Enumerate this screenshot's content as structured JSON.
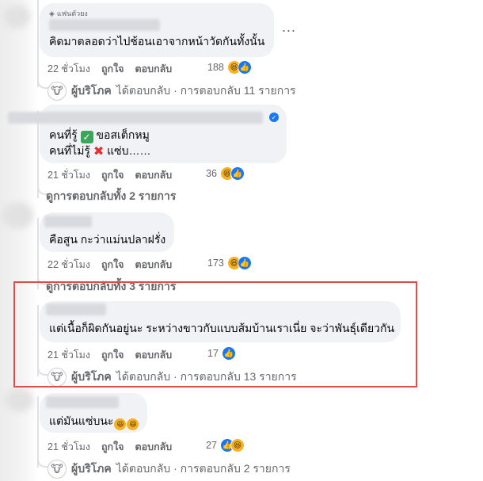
{
  "comments": [
    {
      "badge": "แฟนตัวยง",
      "lines": [
        "คิดมาตลอดว่าไปช้อนเอาจากหน้าวัดกันทั้งนั้น"
      ],
      "time": "22 ชั่วโมง",
      "like": "ถูกใจ",
      "reply": "ตอบกลับ",
      "reaction_count": "188",
      "reactions": [
        "haha-icon",
        "like-icon"
      ],
      "more": "...",
      "reply_summary": {
        "author": "ผู้บริโภค",
        "text": "ได้ตอบกลับ · การตอบกลับ 11 รายการ"
      }
    },
    {
      "lines": [
        "คนที่รู้ ✅ ขอสเต็กหมู",
        "คนที่ไม่รู้ ❌ แซ่บ……"
      ],
      "line1_a": "คนที่รู้",
      "line1_b": "ขอสเต็กหมู",
      "line2_a": "คนที่ไม่รู้",
      "line2_b": "แซ่บ……",
      "time": "21 ชั่วโมง",
      "like": "ถูกใจ",
      "reply": "ตอบกลับ",
      "reaction_count": "36",
      "reactions": [
        "haha-icon",
        "like-icon"
      ],
      "view_replies": "ดูการตอบกลับทั้ง 2 รายการ"
    },
    {
      "lines": [
        "คือสูน กะว่าแม่นปลาฝรั่ง"
      ],
      "time": "22 ชั่วโมง",
      "like": "ถูกใจ",
      "reply": "ตอบกลับ",
      "reaction_count": "173",
      "reactions": [
        "haha-icon",
        "like-icon"
      ],
      "view_replies": "ดูการตอบกลับทั้ง 3 รายการ"
    },
    {
      "lines": [
        "แต่เนื้อก็ผิดกันอยู่นะ ระหว่างขาวกับแบบส้มบ้านเราเนี่ย จะว่าพันธุ์เดียวกัน"
      ],
      "time": "21 ชั่วโมง",
      "like": "ถูกใจ",
      "reply": "ตอบกลับ",
      "reaction_count": "17",
      "reactions": [
        "like-icon"
      ],
      "reply_summary": {
        "author": "ผู้บริโภค",
        "text": "ได้ตอบกลับ · การตอบกลับ 13 รายการ"
      }
    },
    {
      "lines": [
        "แต่มันแซ่บนะ😆😆"
      ],
      "text": "แต่มันแซ่บนะ",
      "time": "21 ชั่วโมง",
      "like": "ถูกใจ",
      "reply": "ตอบกลับ",
      "reaction_count": "27",
      "reactions": [
        "like-icon",
        "haha-icon"
      ],
      "reply_summary": {
        "author": "ผู้บริโภค",
        "text": "ได้ตอบกลับ · การตอบกลับ 2 รายการ"
      }
    }
  ],
  "colors": {
    "highlight": "#d9504a",
    "bubble": "#f0f2f5",
    "meta": "#65676b",
    "like": "#1877f2"
  }
}
